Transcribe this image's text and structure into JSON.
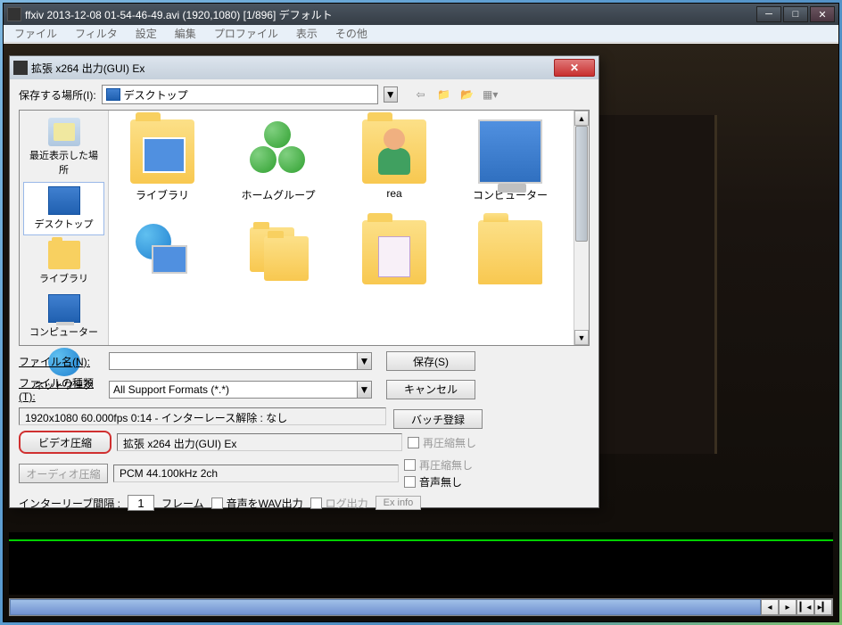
{
  "mainWindow": {
    "title": "ffxiv 2013-12-08 01-54-46-49.avi (1920,1080) [1/896] デフォルト"
  },
  "menubar": {
    "items": [
      "ファイル",
      "フィルタ",
      "設定",
      "編集",
      "プロファイル",
      "表示",
      "その他"
    ]
  },
  "saveDialog": {
    "title": "拡張 x264 出力(GUI) Ex",
    "locationLabel": "保存する場所(I):",
    "locationValue": "デスクトップ",
    "places": [
      {
        "label": "最近表示した場所"
      },
      {
        "label": "デスクトップ"
      },
      {
        "label": "ライブラリ"
      },
      {
        "label": "コンピューター"
      },
      {
        "label": "ネットワーク"
      }
    ],
    "files": [
      {
        "label": "ライブラリ"
      },
      {
        "label": "ホームグループ"
      },
      {
        "label": "rea"
      },
      {
        "label": "コンピューター"
      }
    ],
    "filenameLabel": "ファイル名(N):",
    "filenameValue": "",
    "filetypeLabel": "ファイルの種類(T):",
    "filetypeValue": "All Support Formats (*.*)",
    "saveBtn": "保存(S)",
    "cancelBtn": "キャンセル",
    "videoInfo": "1920x1080 60.000fps 0:14 - インターレース解除 : なし",
    "batchBtn": "バッチ登録",
    "videoCompressBtn": "ビデオ圧縮",
    "videoCompressInfo": "拡張 x264 出力(GUI) Ex",
    "audioCompressBtn": "オーディオ圧縮",
    "audioCompressInfo": "PCM 44.100kHz 2ch",
    "noRecompress": "再圧縮無し",
    "noAudio": "音声無し",
    "interleaveLabel": "インターリーブ間隔 :",
    "interleaveValue": "1",
    "interleaveUnit": "フレーム",
    "wavOutput": "音声をWAV出力",
    "logOutput": "ログ出力",
    "exInfo": "Ex info"
  }
}
